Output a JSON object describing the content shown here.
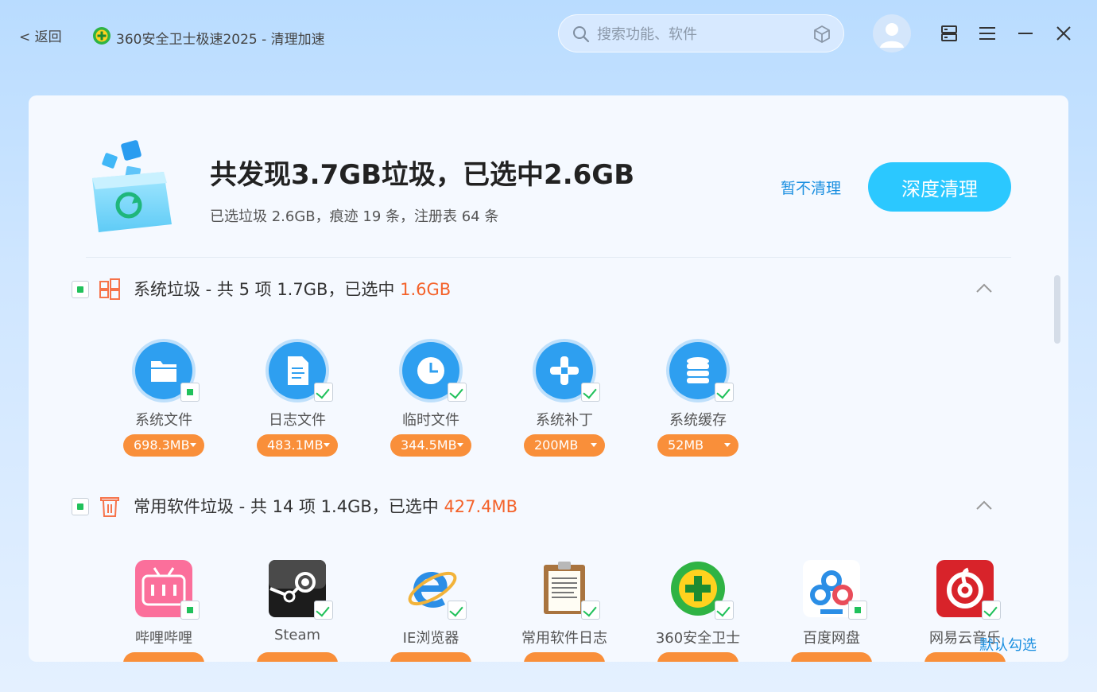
{
  "titlebar": {
    "back_label": "< 返回",
    "app_title": "360安全卫士极速2025 - 清理加速",
    "search_placeholder": "搜索功能、软件"
  },
  "summary": {
    "title": "共发现3.7GB垃圾，已选中2.6GB",
    "subtitle": "已选垃圾 2.6GB，痕迹 19 条，注册表 64 条",
    "skip_label": "暂不清理",
    "deep_clean_label": "深度清理"
  },
  "sections": [
    {
      "title_prefix": "系统垃圾 - 共 5 项 1.7GB，已选中 ",
      "selected": "1.6GB",
      "items": [
        {
          "icon": "folder-icon",
          "label": "系统文件",
          "size": "698.3MB",
          "check": "partial"
        },
        {
          "icon": "document-icon",
          "label": "日志文件",
          "size": "483.1MB",
          "check": "full"
        },
        {
          "icon": "clock-icon",
          "label": "临时文件",
          "size": "344.5MB",
          "check": "full"
        },
        {
          "icon": "patch-plus-icon",
          "label": "系统补丁",
          "size": "200MB",
          "check": "full"
        },
        {
          "icon": "database-icon",
          "label": "系统缓存",
          "size": "52MB",
          "check": "full"
        }
      ]
    },
    {
      "title_prefix": "常用软件垃圾 - 共 14 项 1.4GB，已选中 ",
      "selected": "427.4MB",
      "items": [
        {
          "icon": "bilibili-icon",
          "label": "哔哩哔哩",
          "check": "partial"
        },
        {
          "icon": "steam-icon",
          "label": "Steam",
          "check": "full"
        },
        {
          "icon": "ie-browser-icon",
          "label": "IE浏览器",
          "check": "full"
        },
        {
          "icon": "clipboard-log-icon",
          "label": "常用软件日志",
          "check": "full"
        },
        {
          "icon": "360-security-icon",
          "label": "360安全卫士",
          "check": "full"
        },
        {
          "icon": "baidu-netdisk-icon",
          "label": "百度网盘",
          "check": "partial"
        },
        {
          "icon": "netease-music-icon",
          "label": "网易云音乐",
          "check": "full"
        }
      ]
    }
  ],
  "footer": {
    "default_check_label": "默认勾选"
  },
  "colors": {
    "accent": "#2bc8ff",
    "link": "#1a8fe0",
    "highlight": "#f4622a",
    "pill": "#f98f3a",
    "check": "#21c15b"
  }
}
